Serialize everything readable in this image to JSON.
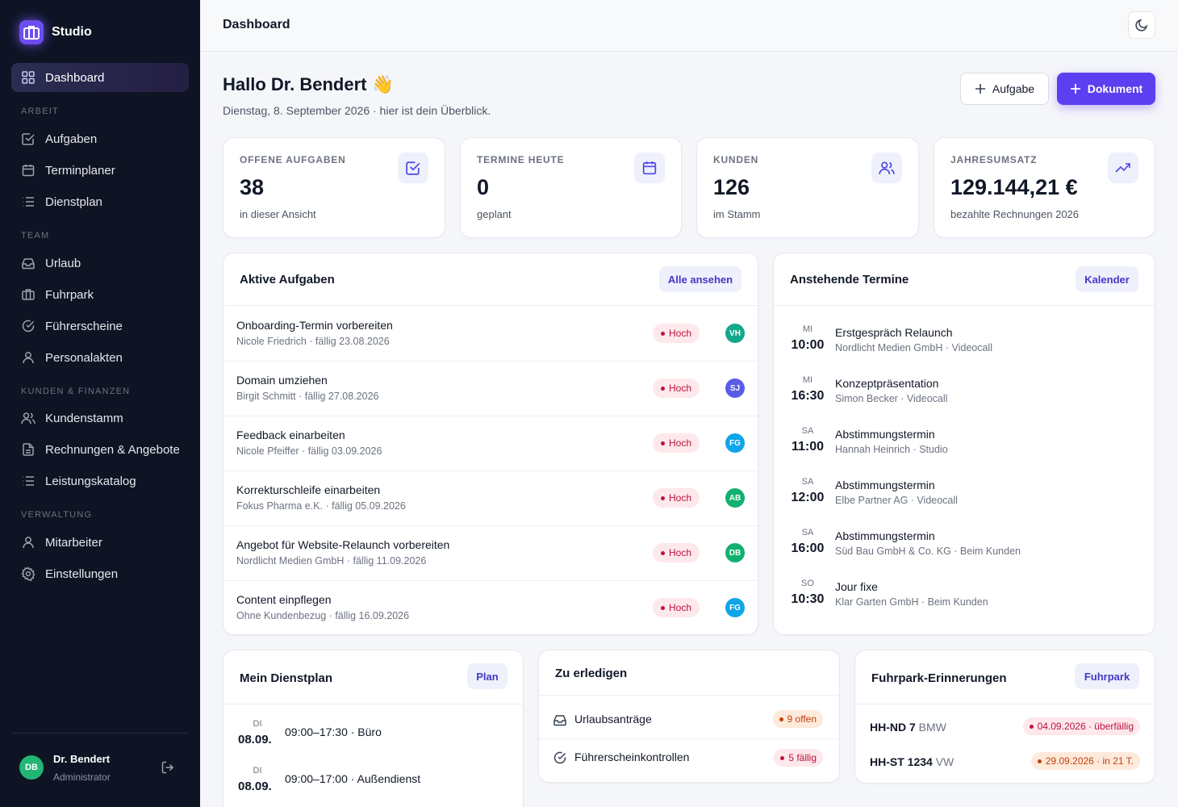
{
  "app": {
    "name": "Studio"
  },
  "sidebar": {
    "dashboard": "Dashboard",
    "sections": {
      "arbeit": "ARBEIT",
      "team": "TEAM",
      "kunden": "KUNDEN & FINANZEN",
      "verwaltung": "VERWALTUNG"
    },
    "items": {
      "aufgaben": "Aufgaben",
      "terminplaner": "Terminplaner",
      "dienstplan": "Dienstplan",
      "urlaub": "Urlaub",
      "fuhrpark": "Fuhrpark",
      "fuehrerscheine": "Führerscheine",
      "personalakten": "Personalakten",
      "kundenstamm": "Kundenstamm",
      "rechnungen": "Rechnungen & Angebote",
      "leistungskatalog": "Leistungskatalog",
      "mitarbeiter": "Mitarbeiter",
      "einstellungen": "Einstellungen"
    },
    "user": {
      "initials": "DB",
      "name": "Dr. Bendert",
      "role": "Administrator"
    }
  },
  "header": {
    "title": "Dashboard"
  },
  "greeting": {
    "title": "Hallo Dr. Bendert 👋",
    "subtitle": "Dienstag, 8. September 2026 · hier ist dein Überblick.",
    "btn_task": "Aufgabe",
    "btn_document": "Dokument"
  },
  "stats": [
    {
      "label": "OFFENE AUFGABEN",
      "value": "38",
      "sub": "in dieser Ansicht"
    },
    {
      "label": "TERMINE HEUTE",
      "value": "0",
      "sub": "geplant"
    },
    {
      "label": "KUNDEN",
      "value": "126",
      "sub": "im Stamm"
    },
    {
      "label": "JAHRESUMSATZ",
      "value": "129.144,21 €",
      "sub": "bezahlte Rechnungen 2026"
    }
  ],
  "tasks_card": {
    "title": "Aktive Aufgaben",
    "action": "Alle ansehen",
    "items": [
      {
        "title": "Onboarding-Termin vorbereiten",
        "meta": "Nicole Friedrich · fällig 23.08.2026",
        "priority": "Hoch",
        "initials": "VH",
        "color": "#14a88a"
      },
      {
        "title": "Domain umziehen",
        "meta": "Birgit Schmitt · fällig 27.08.2026",
        "priority": "Hoch",
        "initials": "SJ",
        "color": "#5b5ce6"
      },
      {
        "title": "Feedback einarbeiten",
        "meta": "Nicole Pfeiffer · fällig 03.09.2026",
        "priority": "Hoch",
        "initials": "FG",
        "color": "#0ea5e9"
      },
      {
        "title": "Korrekturschleife einarbeiten",
        "meta": "Fokus Pharma e.K. · fällig 05.09.2026",
        "priority": "Hoch",
        "initials": "AB",
        "color": "#12b06e"
      },
      {
        "title": "Angebot für Website-Relaunch vorbereiten",
        "meta": "Nordlicht Medien GmbH · fällig 11.09.2026",
        "priority": "Hoch",
        "initials": "DB",
        "color": "#12b06e"
      },
      {
        "title": "Content einpflegen",
        "meta": "Ohne Kundenbezug · fällig 16.09.2026",
        "priority": "Hoch",
        "initials": "FG",
        "color": "#0ea5e9"
      }
    ]
  },
  "appointments_card": {
    "title": "Anstehende Termine",
    "action": "Kalender",
    "items": [
      {
        "day": "MI",
        "time": "10:00",
        "title": "Erstgespräch Relaunch",
        "meta": "Nordlicht Medien GmbH · Videocall"
      },
      {
        "day": "MI",
        "time": "16:30",
        "title": "Konzeptpräsentation",
        "meta": "Simon Becker · Videocall"
      },
      {
        "day": "SA",
        "time": "11:00",
        "title": "Abstimmungstermin",
        "meta": "Hannah Heinrich · Studio"
      },
      {
        "day": "SA",
        "time": "12:00",
        "title": "Abstimmungstermin",
        "meta": "Elbe Partner AG · Videocall"
      },
      {
        "day": "SA",
        "time": "16:00",
        "title": "Abstimmungstermin",
        "meta": "Süd Bau GmbH & Co. KG · Beim Kunden"
      },
      {
        "day": "SO",
        "time": "10:30",
        "title": "Jour fixe",
        "meta": "Klar Garten GmbH · Beim Kunden"
      }
    ]
  },
  "shift_card": {
    "title": "Mein Dienstplan",
    "action": "Plan",
    "items": [
      {
        "day": "DI",
        "date": "08.09.",
        "text": "09:00–17:30 · Büro"
      },
      {
        "day": "DI",
        "date": "08.09.",
        "text": "09:00–17:00 · Außendienst"
      }
    ]
  },
  "todo_card": {
    "title": "Zu erledigen",
    "items": [
      {
        "label": "Urlaubsanträge",
        "badge": "9 offen"
      },
      {
        "label": "Führerscheinkontrollen",
        "badge": "5 fällig"
      }
    ]
  },
  "fleet_card": {
    "title": "Fuhrpark-Erinnerungen",
    "action": "Fuhrpark",
    "items": [
      {
        "plate": "HH-ND 7",
        "make": "BMW",
        "badge": "04.09.2026 · überfällig"
      },
      {
        "plate": "HH-ST 1234",
        "make": "VW",
        "badge": "29.09.2026 · in 21 T."
      }
    ]
  },
  "colors": {
    "accent": "#5b3ff0",
    "sidebar": "#0f1424",
    "danger": "#be123c",
    "warning": "#c2410c"
  }
}
